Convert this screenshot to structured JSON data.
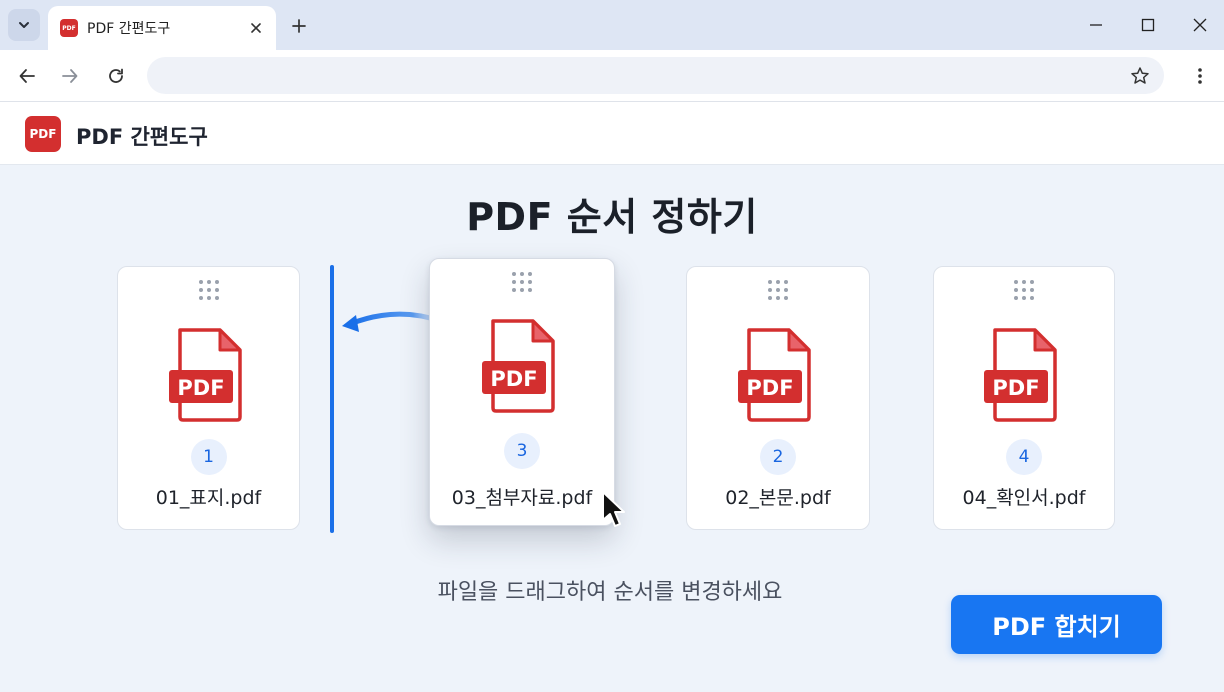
{
  "browser": {
    "tab_title": "PDF 간편도구",
    "favicon_text": "PDF",
    "url": ""
  },
  "app": {
    "logo_text": "PDF",
    "name": "PDF 간편도구"
  },
  "main": {
    "title": "PDF 순서 정하기",
    "files": [
      {
        "order": "1",
        "name": "01_표지.pdf",
        "icon_label": "PDF",
        "state": "normal"
      },
      {
        "order": "3",
        "name": "03_첨부자료.pdf",
        "icon_label": "PDF",
        "state": "dragging"
      },
      {
        "order": "2",
        "name": "02_본문.pdf",
        "icon_label": "PDF",
        "state": "normal"
      },
      {
        "order": "4",
        "name": "04_확인서.pdf",
        "icon_label": "PDF",
        "state": "normal"
      }
    ],
    "hint": "파일을 드래그하여 순서를 변경하세요",
    "merge_button": "PDF 합치기"
  },
  "colors": {
    "brand_red": "#d32f2f",
    "accent_blue": "#1876f2",
    "badge_bg": "#e8f0fd",
    "page_bg": "#eef3fa"
  },
  "icons": {
    "tab_search": "chevron-down-icon",
    "tab_close": "close-icon",
    "new_tab": "plus-icon",
    "back": "arrow-left-icon",
    "forward": "arrow-right-icon",
    "reload": "reload-icon",
    "bookmark": "star-icon",
    "menu": "more-vert-icon",
    "grip": "drag-grip-icon",
    "file": "pdf-file-icon",
    "cursor": "mouse-pointer-icon",
    "arrow": "curved-arrow-left-icon"
  }
}
